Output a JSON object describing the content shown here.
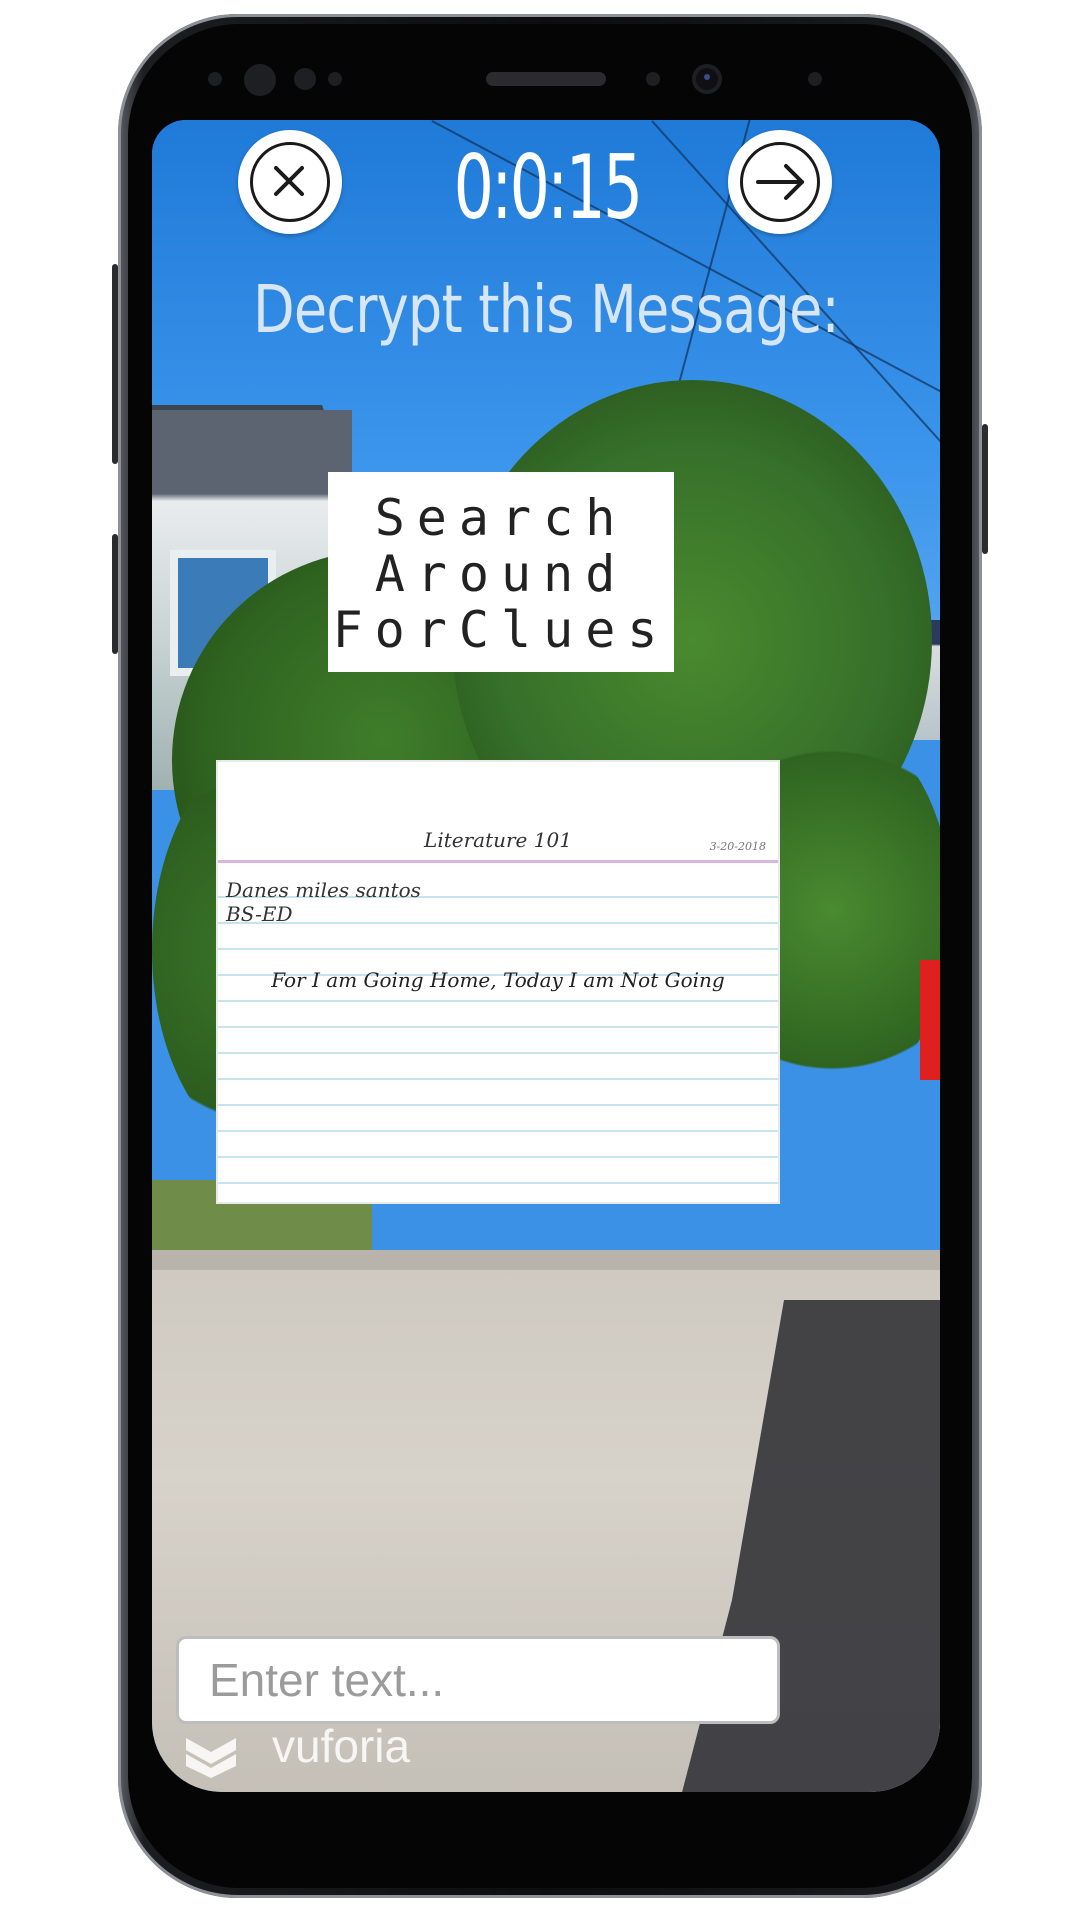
{
  "timer": {
    "text": "0:0:15"
  },
  "headline": "Decrypt this Message:",
  "cipher_card": {
    "lines": [
      "Search",
      "Around",
      "ForClues"
    ]
  },
  "note_card": {
    "title": "Literature 101",
    "date": "3-20-2018",
    "name": "Danes miles santos",
    "course": "BS-ED",
    "message": "For I am Going Home, Today I am Not Going"
  },
  "input": {
    "placeholder": "Enter text...",
    "value": ""
  },
  "watermark": {
    "text": "vuforia"
  },
  "icons": {
    "close": "close-x-icon",
    "next": "arrow-right-icon",
    "watermark": "vuforia-logo-icon"
  },
  "colors": {
    "sky": "#2a83e0",
    "hud_text": "#ffffff",
    "input_border": "#bdbdbd"
  }
}
